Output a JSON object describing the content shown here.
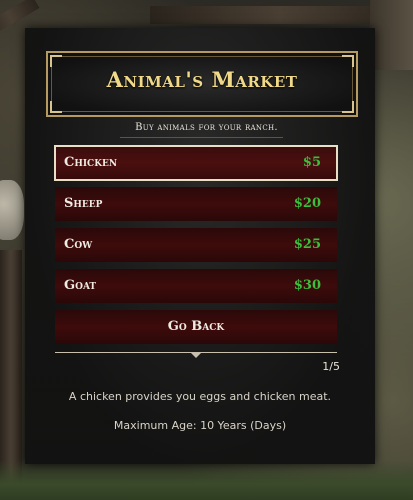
{
  "header": {
    "title": "Animal's Market"
  },
  "subtitle": "Buy animals for your ranch.",
  "menu": {
    "items": [
      {
        "label": "Chicken",
        "price": "$5"
      },
      {
        "label": "Sheep",
        "price": "$20"
      },
      {
        "label": "Cow",
        "price": "$25"
      },
      {
        "label": "Goat",
        "price": "$30"
      }
    ],
    "back_label": "Go Back"
  },
  "pager": "1/5",
  "description": "A chicken provides you eggs and chicken meat.",
  "max_age": "Maximum Age: 10 Years (Days)",
  "colors": {
    "accent": "#f1d98a",
    "price": "#3cbf3c",
    "row": "#3e0b0b"
  }
}
